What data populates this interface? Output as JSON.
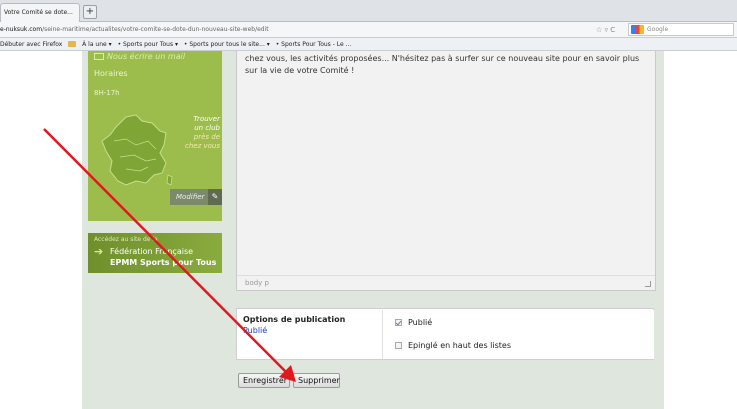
{
  "browser": {
    "tab_title": "Votre Comité se dote...",
    "new_tab": "+",
    "url_host": "e-nuksuk.com",
    "url_path": "/seine-maritime/actualites/votre-comite-se-dote-dun-nouveau-site-web/edit",
    "url_icons": "☆ ▿ C",
    "search_placeholder": "Google",
    "bookmarks": [
      "Débuter avec Firefox",
      "À la une ▾",
      "• Sports pour Tous ▾",
      "• Sports pour tous le site... ▾",
      "• Sports Pour Tous - Le ..."
    ]
  },
  "sidebar": {
    "mail_label": "Nous écrire un mail",
    "hours_title": "Horaires",
    "hours_value": "8H-17h",
    "club_lines": [
      "Trouver",
      "un club",
      "près de",
      "chez vous"
    ],
    "modify_label": "Modifier",
    "federation_access": "Accédez au site de la",
    "federation_line1": "Fédération Française",
    "federation_line2": "EPMM Sports pour Tous"
  },
  "editor": {
    "content": "chez vous, les activités proposées... N'hésitez pas à surfer sur ce nouveau site pour en savoir plus sur la vie de votre Comité !",
    "path": "body  p"
  },
  "publication": {
    "title": "Options de publication",
    "state": "Publié",
    "options": [
      {
        "label": "Publié",
        "checked": true
      },
      {
        "label": "Epinglé en haut des listes",
        "checked": false
      }
    ]
  },
  "actions": {
    "save_label": "Enregistrer",
    "delete_label": "Supprimer"
  },
  "colors": {
    "annotation_arrow": "#e0191f",
    "sidebar_green": "#9cbd4b",
    "publish_state": "#1a3eb8"
  }
}
